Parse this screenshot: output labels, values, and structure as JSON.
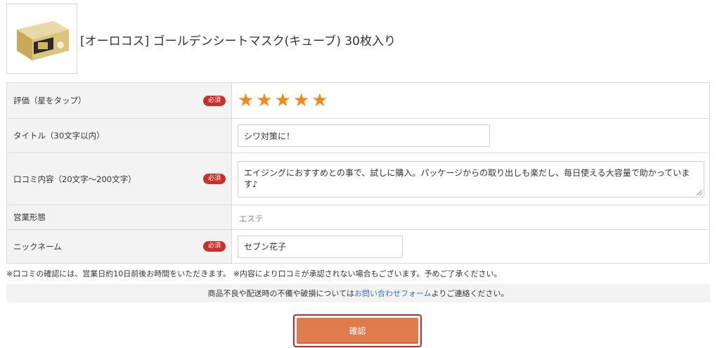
{
  "product": {
    "title": "[オーロコス] ゴールデンシートマスク(キューブ) 30枚入り"
  },
  "form": {
    "required_badge": "必須",
    "rating": {
      "label": "評価（星をタップ）",
      "value": 5,
      "max": 5,
      "star_color": "#f08a1c",
      "icon": "star-icon"
    },
    "title_field": {
      "label": "タイトル（30文字以内）",
      "value": "シワ対策に！"
    },
    "review_field": {
      "label": "口コミ内容（20文字～200文字）",
      "value": "エイジングにおすすめとの事で、試しに購入。パッケージからの取り出しも楽だし、毎日使える大容量で助かっています♪"
    },
    "business_type": {
      "label": "営業形態",
      "value": "エステ"
    },
    "nickname_field": {
      "label": "ニックネーム",
      "value": "セブン花子"
    }
  },
  "notice": "※口コミの確認には、営業日約10日前後お時間をいただきます。 ※内容により口コミが承認されない場合もございます。予めご了承ください。",
  "contact": {
    "prefix": "商品不良や配送時の不備や破損については",
    "link_text": "お問い合わせフォーム",
    "suffix": "よりご連絡ください。"
  },
  "confirm_button": "確認",
  "colors": {
    "badge": "#c9302c",
    "button": "#e07b4e",
    "button_outline": "#c1272d",
    "link": "#3b6fb6"
  }
}
